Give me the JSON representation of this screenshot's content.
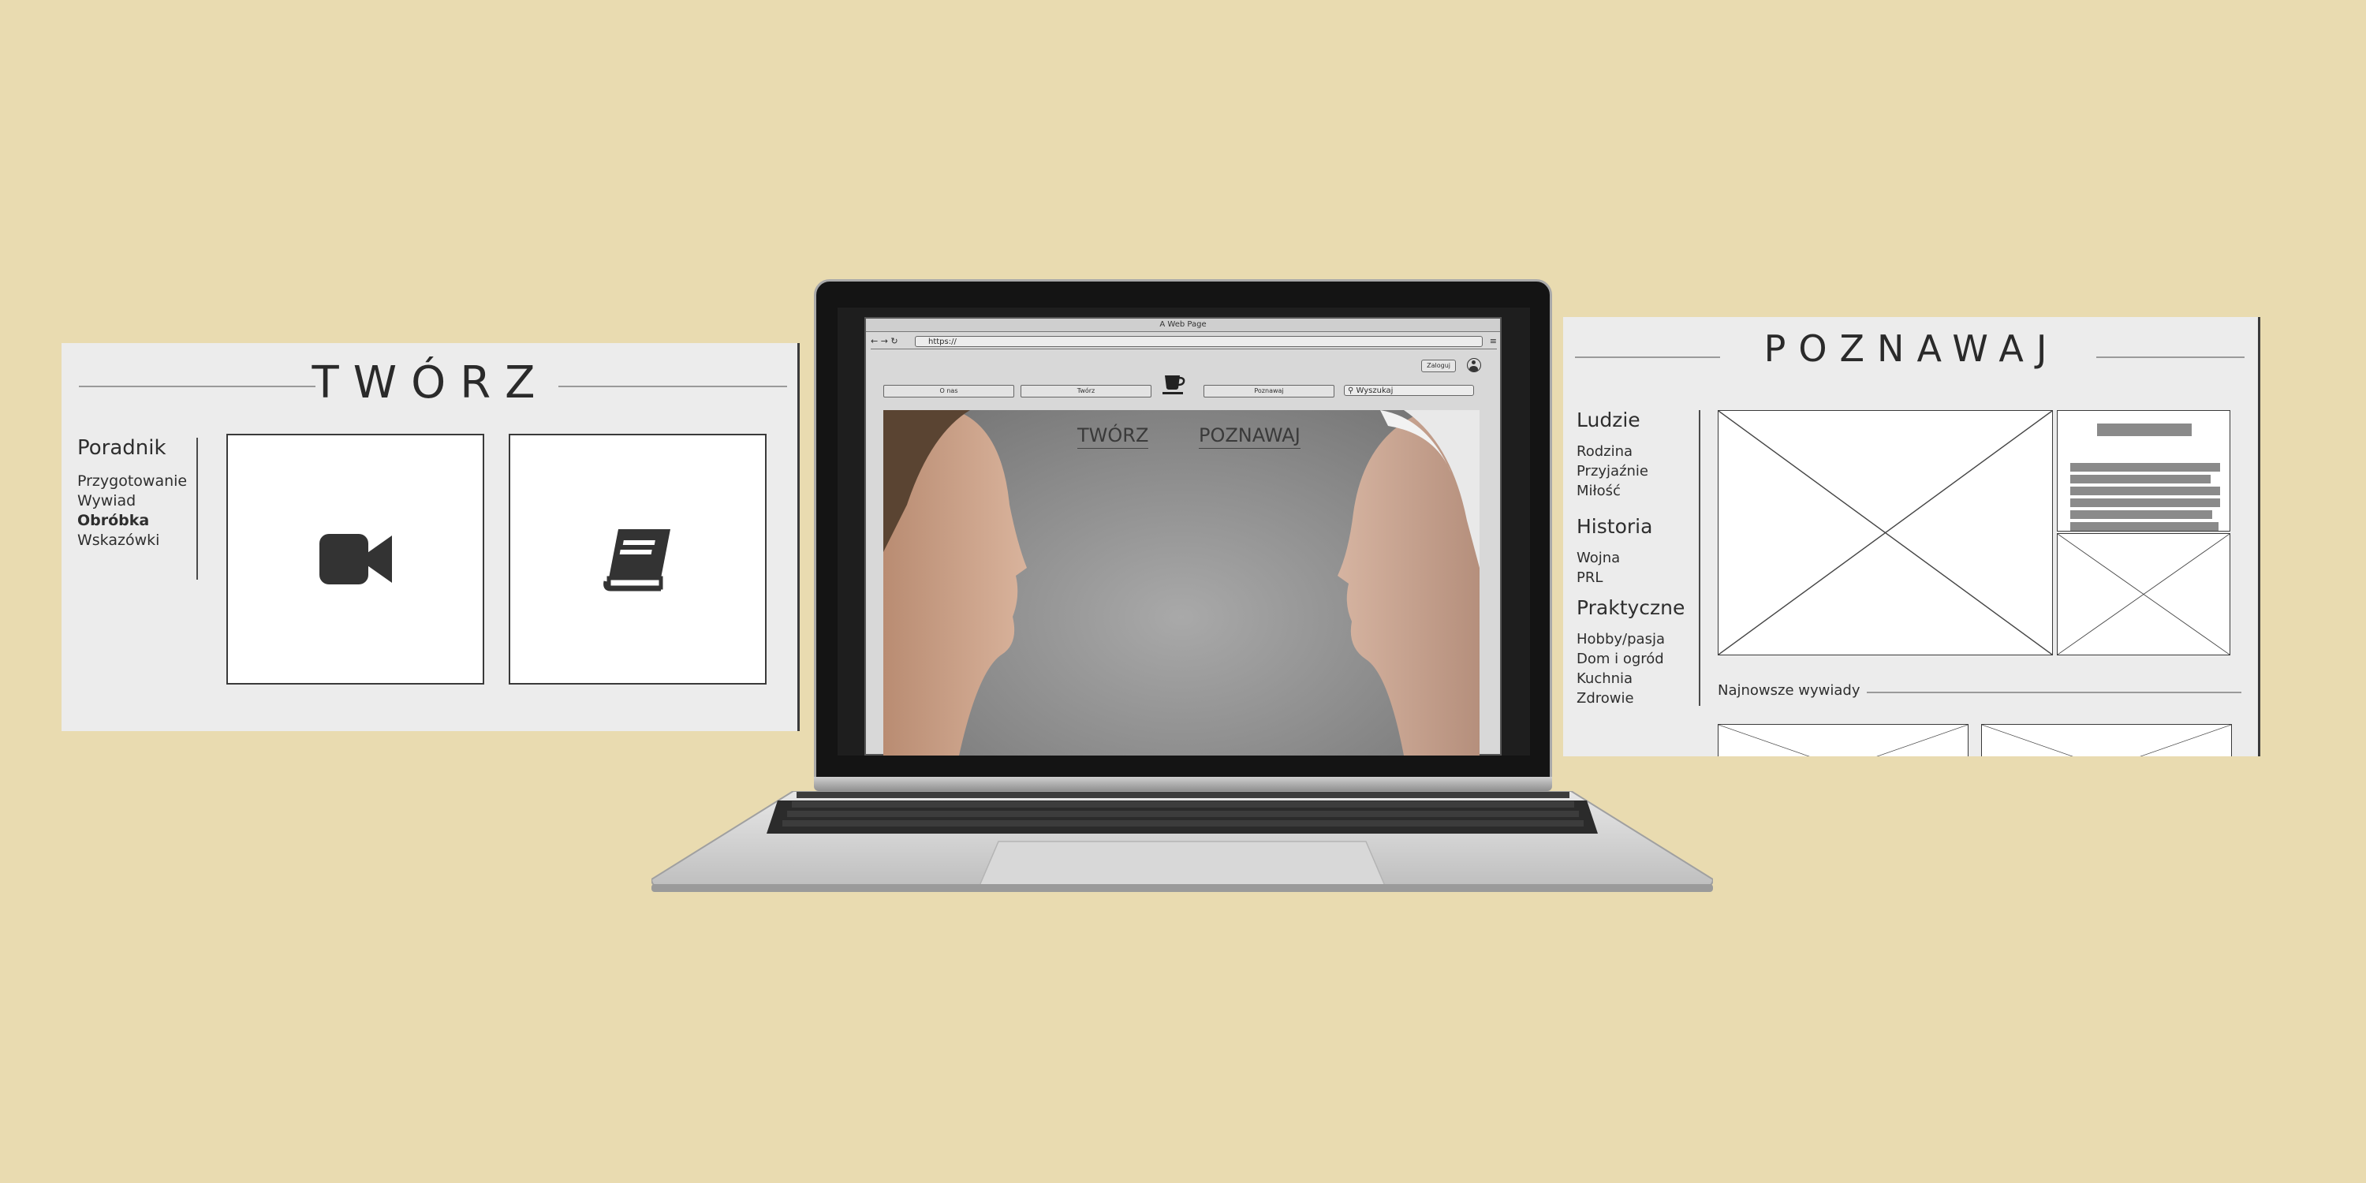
{
  "left_panel": {
    "title": "TWÓRZ",
    "side_heading": "Poradnik",
    "side_items": [
      "Przygotowanie",
      "Wywiad",
      "Obróbka",
      "Wskazówki"
    ],
    "active_item": "Obróbka",
    "cards": [
      {
        "icon": "video-camera-icon"
      },
      {
        "icon": "book-icon"
      }
    ]
  },
  "right_panel": {
    "title": "POZNAWAJ",
    "categories": [
      {
        "heading": "Ludzie",
        "items": [
          "Rodzina",
          "Przyjaźnie",
          "Miłość"
        ]
      },
      {
        "heading": "Historia",
        "items": [
          "Wojna",
          "PRL"
        ]
      },
      {
        "heading": "Praktyczne",
        "items": [
          "Hobby/pasja",
          "Dom i ogród",
          "Kuchnia",
          "Zdrowie"
        ]
      }
    ],
    "latest_label": "Najnowsze wywiady"
  },
  "browser": {
    "window_title": "A Web Page",
    "url": "https://",
    "login_label": "Zaloguj",
    "nav": [
      "O nas",
      "Twórz",
      "Poznawaj"
    ],
    "search_placeholder": "Wyszukaj",
    "logo_icon": "coffee-cup-icon",
    "hero_links": [
      "TWÓRZ",
      "POZNAWAJ"
    ]
  },
  "colors": {
    "background": "#e9dbb0",
    "panel": "#ececec",
    "ink": "#2e2e2e"
  }
}
